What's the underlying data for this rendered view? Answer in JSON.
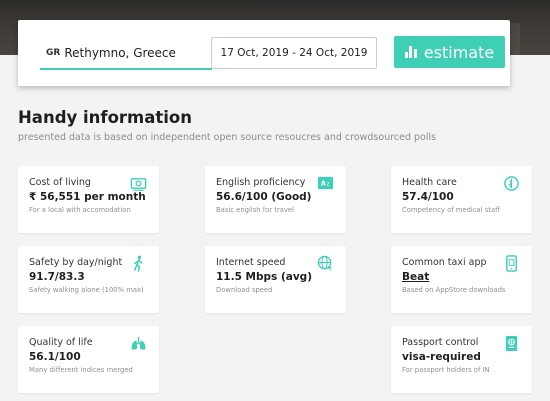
{
  "colors": {
    "accent": "#3ecfb4",
    "background": "#f2f3f4",
    "card": "#ffffff"
  },
  "search": {
    "country_code": "GR",
    "location_value": "Rethymno, Greece",
    "dates_value": "17 Oct, 2019 - 24 Oct, 2019",
    "estimate_label": "estimate",
    "estimate_icon": "bar-chart-icon"
  },
  "info": {
    "title": "Handy information",
    "subtitle": "presented data is based on independent open source resoucres and crowdsourced polls"
  },
  "cards": [
    {
      "label": "Cost of living",
      "value": "₹ 56,551 per month",
      "note": "For a local with accomodation",
      "icon": "money-icon"
    },
    {
      "label": "English proficiency",
      "value": "56.6/100 (Good)",
      "note": "Basic english for travel",
      "icon": "translate-icon"
    },
    {
      "label": "Health care",
      "value": "57.4/100",
      "note": "Competency of medical staff",
      "icon": "healthcare-icon"
    },
    {
      "label": "Safety by day/night",
      "value": "91.7/83.3",
      "note": "Safety walking alone (100% max)",
      "icon": "walking-person-icon"
    },
    {
      "label": "Internet speed",
      "value": "11.5 Mbps (avg)",
      "note": "Download speed",
      "icon": "globe-cursor-icon"
    },
    {
      "label": "Common taxi app",
      "value": "Beat",
      "note": "Based on AppStore downloads",
      "icon": "mobile-app-icon"
    },
    {
      "label": "Quality of life",
      "value": "56.1/100",
      "note": "Many different indices merged",
      "icon": "lungs-icon"
    },
    {
      "label": "Passport control",
      "value": "visa-required",
      "note": "For passport holders of IN",
      "icon": "passport-icon"
    }
  ]
}
